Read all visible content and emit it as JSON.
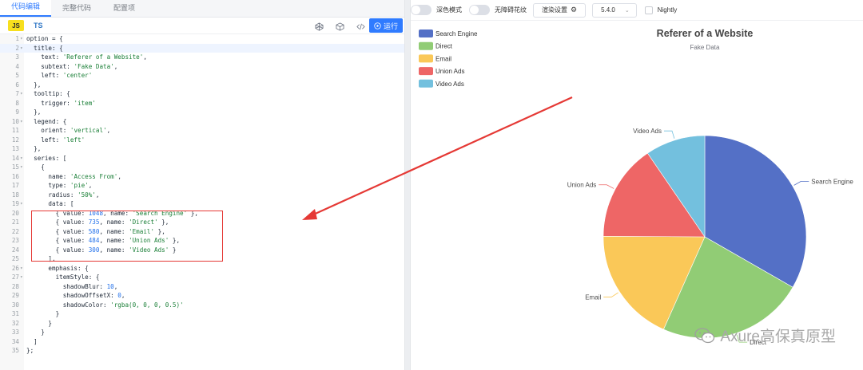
{
  "editor": {
    "tabs": [
      "代码编辑",
      "完整代码",
      "配置项"
    ],
    "active_tab": 0,
    "lang_js": "JS",
    "lang_ts": "TS",
    "run_label": "运行",
    "lines": [
      "option = {",
      "  title: {",
      "    text: 'Referer of a Website',",
      "    subtext: 'Fake Data',",
      "    left: 'center'",
      "  },",
      "  tooltip: {",
      "    trigger: 'item'",
      "  },",
      "  legend: {",
      "    orient: 'vertical',",
      "    left: 'left'",
      "  },",
      "  series: [",
      "    {",
      "      name: 'Access From',",
      "      type: 'pie',",
      "      radius: '50%',",
      "      data: [",
      "        { value: 1048, name: 'Search Engine' },",
      "        { value: 735, name: 'Direct' },",
      "        { value: 580, name: 'Email' },",
      "        { value: 484, name: 'Union Ads' },",
      "        { value: 300, name: 'Video Ads' }",
      "      ],",
      "      emphasis: {",
      "        itemStyle: {",
      "          shadowBlur: 10,",
      "          shadowOffsetX: 0,",
      "          shadowColor: 'rgba(0, 0, 0, 0.5)'",
      "        }",
      "      }",
      "    }",
      "  ]",
      "};"
    ],
    "fold_lines": [
      1,
      2,
      7,
      10,
      14,
      15,
      19,
      26,
      27
    ]
  },
  "preview": {
    "dark_mode_label": "深色模式",
    "accessible_label": "无障碍花纹",
    "render_settings_label": "渲染设置",
    "version": "5.4.0",
    "nightly_label": "Nightly"
  },
  "chart_data": {
    "type": "pie",
    "title": "Referer of a Website",
    "subtitle": "Fake Data",
    "legend_position": "top-left",
    "slices": [
      {
        "name": "Search Engine",
        "value": 1048,
        "color": "#5470c6"
      },
      {
        "name": "Direct",
        "value": 735,
        "color": "#91cc75"
      },
      {
        "name": "Email",
        "value": 580,
        "color": "#fac858"
      },
      {
        "name": "Union Ads",
        "value": 484,
        "color": "#ee6666"
      },
      {
        "name": "Video Ads",
        "value": 300,
        "color": "#73c0de"
      }
    ]
  },
  "watermark": "Axure高保真原型",
  "annotation_color": "#e53935"
}
